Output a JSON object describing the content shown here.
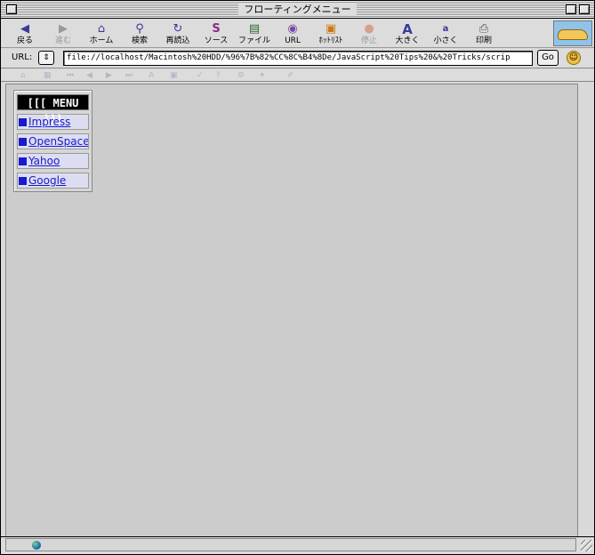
{
  "window": {
    "title": "フローティングメニュー"
  },
  "toolbar": {
    "buttons": [
      {
        "label": "戻る",
        "icon": "back-arrow-icon",
        "enabled": true
      },
      {
        "label": "進む",
        "icon": "forward-arrow-icon",
        "enabled": false
      },
      {
        "label": "ホーム",
        "icon": "home-icon",
        "enabled": true
      },
      {
        "label": "検索",
        "icon": "search-icon",
        "enabled": true
      },
      {
        "label": "再読込",
        "icon": "reload-icon",
        "enabled": true
      },
      {
        "label": "ソース",
        "icon": "source-icon",
        "enabled": true
      },
      {
        "label": "ファイル",
        "icon": "file-icon",
        "enabled": true
      },
      {
        "label": "URL",
        "icon": "url-icon",
        "enabled": true
      },
      {
        "label": "ﾎｯﾄﾘｽﾄ",
        "icon": "hotlist-icon",
        "enabled": true
      },
      {
        "label": "停止",
        "icon": "stop-icon",
        "enabled": false
      },
      {
        "label": "大きく",
        "icon": "text-larger-icon",
        "enabled": true
      },
      {
        "label": "小さく",
        "icon": "text-smaller-icon",
        "enabled": true
      },
      {
        "label": "印刷",
        "icon": "print-icon",
        "enabled": true
      }
    ]
  },
  "address": {
    "label": "URL:",
    "url": "file://localhost/Macintosh%20HDD/%96%7B%82%CC%8C%B4%8De/JavaScript%20Tips%20&%20Tricks/scrip",
    "go_label": "Go"
  },
  "menu": {
    "title": "[[[ MENU ]]]",
    "items": [
      {
        "label": "Impress"
      },
      {
        "label": "OpenSpace"
      },
      {
        "label": "Yahoo"
      },
      {
        "label": "Google"
      }
    ]
  },
  "colors": {
    "link": "#1a1acc",
    "menu_item_bg": "#ddddf2",
    "page_bg": "#cccccc"
  }
}
